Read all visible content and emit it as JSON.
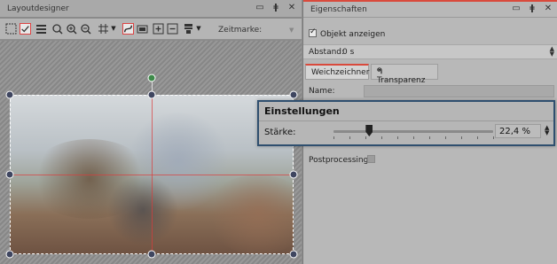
{
  "left_panel": {
    "title": "Layoutdesigner",
    "controls": [
      "▭",
      "ǂ",
      "✕"
    ],
    "toolbar": {
      "zeitmarke_label": "Zeitmarke:",
      "icons": [
        "select-frame-icon",
        "checkbox-icon",
        "layers-icon",
        "zoom-fit-icon",
        "zoom-in-icon",
        "zoom-out-icon",
        "grid-icon",
        "dropdown-arrow-icon",
        "curve-path-icon",
        "image-frame-icon",
        "add-point-icon",
        "remove-point-icon",
        "align-icon",
        "dropdown-arrow-icon"
      ]
    }
  },
  "right_panel": {
    "title": "Eigenschaften",
    "controls": [
      "▭",
      "ǂ",
      "✕"
    ],
    "show_object_label": "Objekt anzeigen",
    "show_object_checked": true,
    "abstand_label": "Abstand:",
    "abstand_value": "0 s",
    "tabs": [
      {
        "label": "Weichzeichner",
        "active": true
      },
      {
        "label": "Transparenz",
        "active": false
      }
    ],
    "name_label": "Name:",
    "postprocessing_label": "Postprocessing",
    "postprocessing_checked": false
  },
  "popup": {
    "title": "Einstellungen",
    "strength_label": "Stärke:",
    "strength_value": "22,4 %",
    "strength_fraction": 0.224
  },
  "colors": {
    "accent_red": "#d94a3c",
    "popup_border": "#2f4f6f",
    "handle": "#3f4660",
    "rotate_handle": "#3e8a4a"
  }
}
